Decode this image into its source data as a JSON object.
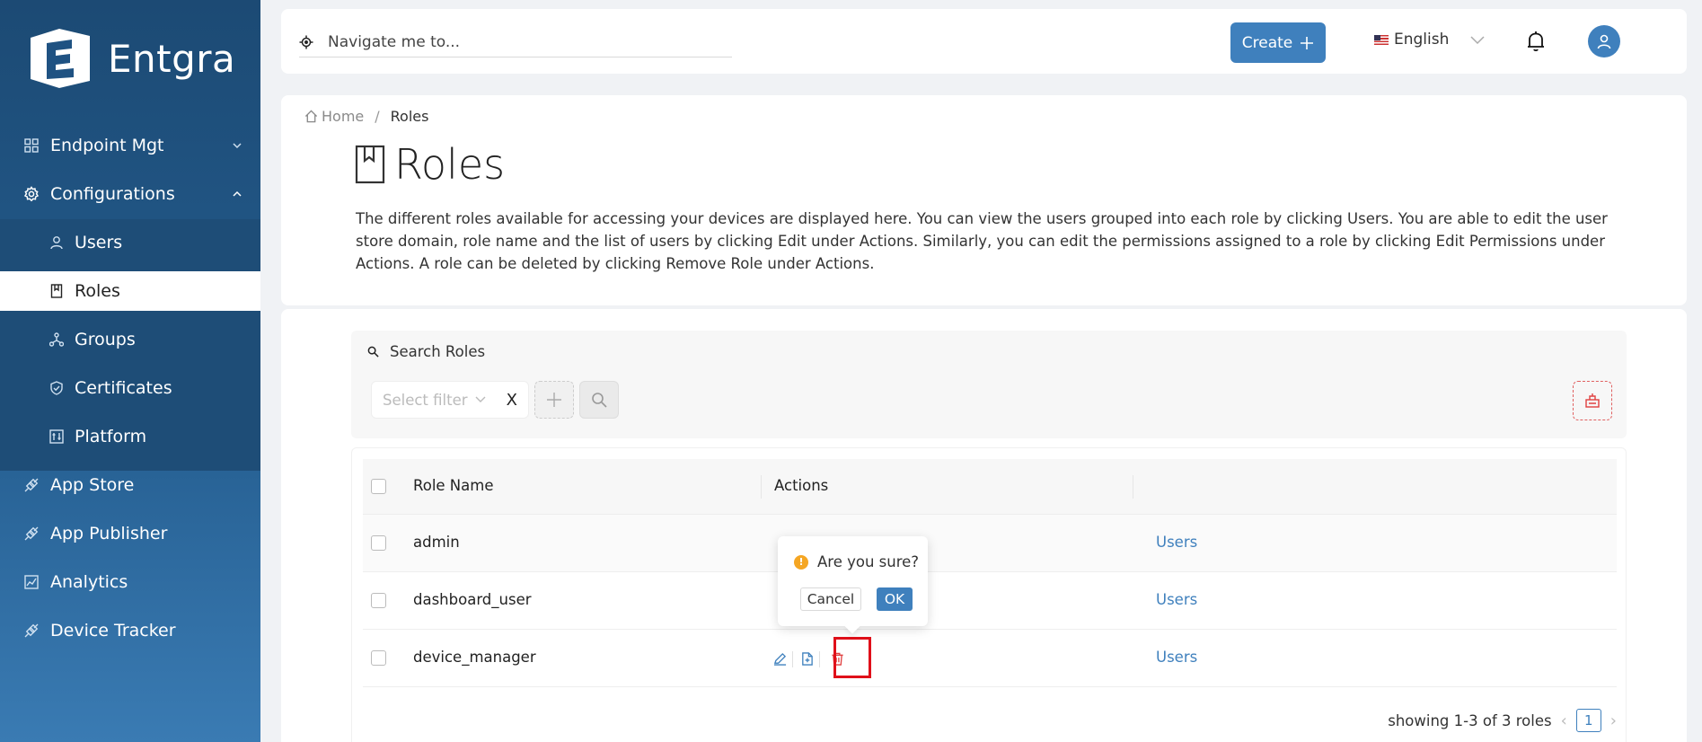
{
  "brand": {
    "name": "Entgra"
  },
  "sidebar": {
    "items": [
      {
        "label": "Endpoint Mgt",
        "icon": "grid-icon"
      },
      {
        "label": "Configurations",
        "icon": "gear-icon"
      },
      {
        "label": "Users",
        "icon": "user-icon"
      },
      {
        "label": "Roles",
        "icon": "bookmark-icon"
      },
      {
        "label": "Groups",
        "icon": "cluster-icon"
      },
      {
        "label": "Certificates",
        "icon": "shield-icon"
      },
      {
        "label": "Platform",
        "icon": "sliders-icon"
      },
      {
        "label": "App Store",
        "icon": "api-icon"
      },
      {
        "label": "App Publisher",
        "icon": "api-icon"
      },
      {
        "label": "Analytics",
        "icon": "fund-icon"
      },
      {
        "label": "Device Tracker",
        "icon": "api-icon"
      }
    ]
  },
  "header": {
    "search_placeholder": "Navigate me to...",
    "create_label": "Create",
    "language": "English"
  },
  "breadcrumb": {
    "home": "Home",
    "current": "Roles"
  },
  "page": {
    "title": "Roles",
    "description": "The different roles available for accessing your devices are displayed here. You can view the users grouped into each role by clicking Users. You are able to edit the user store domain, role name and the list of users by clicking Edit under Actions. Similarly, you can edit the permissions assigned to a role by clicking Edit Permissions under Actions. A role can be deleted by clicking Remove Role under Actions."
  },
  "search": {
    "title": "Search Roles",
    "filter_placeholder": "Select filter",
    "clear": "X"
  },
  "table": {
    "columns": [
      "Role Name",
      "Actions"
    ],
    "rows": [
      {
        "name": "admin",
        "users": "Users"
      },
      {
        "name": "dashboard_user",
        "users": "Users"
      },
      {
        "name": "device_manager",
        "users": "Users"
      }
    ]
  },
  "popconfirm": {
    "message": "Are you sure?",
    "cancel": "Cancel",
    "ok": "OK"
  },
  "pagination": {
    "summary": "showing 1-3 of 3 roles",
    "current_page": "1"
  },
  "colors": {
    "primary": "#3f80bd",
    "sidebar": "#245d8f",
    "danger": "#e0101a",
    "warning": "#f5a623"
  }
}
